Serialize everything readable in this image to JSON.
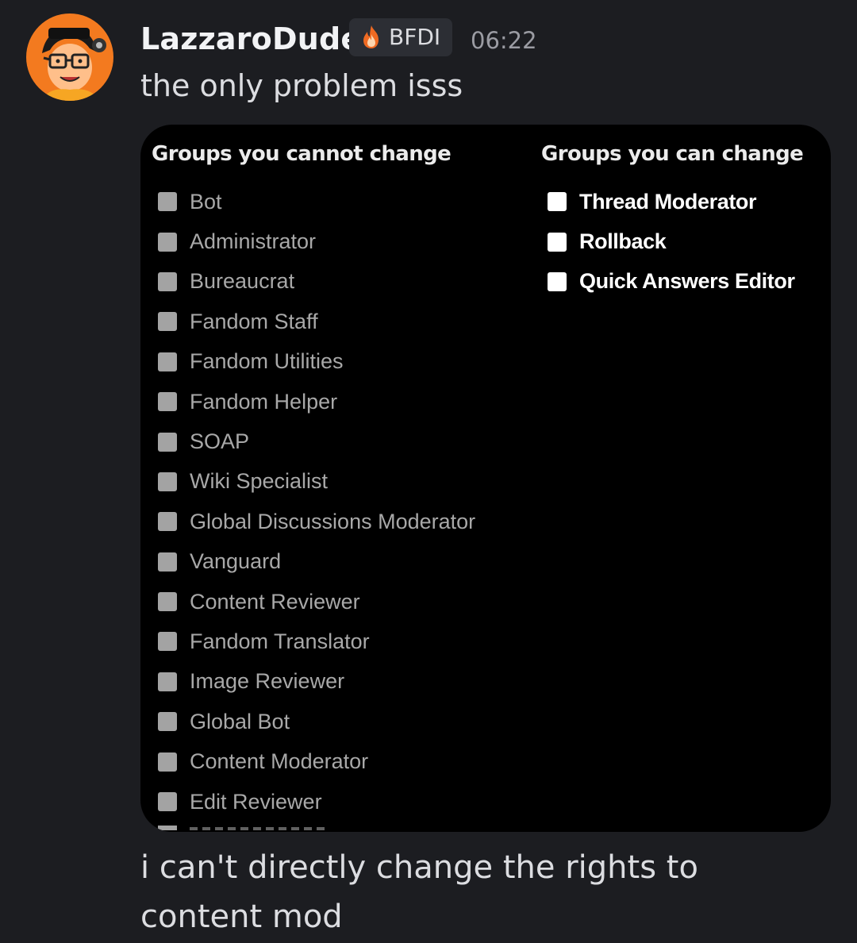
{
  "message": {
    "author": "LazzaroDude",
    "tag": {
      "icon": "flame-icon",
      "label": "BFDI"
    },
    "timestamp": "06:22",
    "text_before": "the only problem isss",
    "text_after": "i can't directly change the rights to content mod"
  },
  "screenshot": {
    "left_heading": "Groups you cannot change",
    "right_heading": "Groups you can change",
    "cannot_change": [
      "Bot",
      "Administrator",
      "Bureaucrat",
      "Fandom Staff",
      "Fandom Utilities",
      "Fandom Helper",
      "SOAP",
      "Wiki Specialist",
      "Global Discussions Moderator",
      "Vanguard",
      "Content Reviewer",
      "Fandom Translator",
      "Image Reviewer",
      "Global Bot",
      "Content Moderator",
      "Edit Reviewer"
    ],
    "can_change": [
      "Thread Moderator",
      "Rollback",
      "Quick Answers Editor"
    ]
  },
  "colors": {
    "background": "#1c1d21",
    "embed_background": "#000000",
    "tag_background": "#2c2e34",
    "avatar_orange": "#f37a1f"
  }
}
